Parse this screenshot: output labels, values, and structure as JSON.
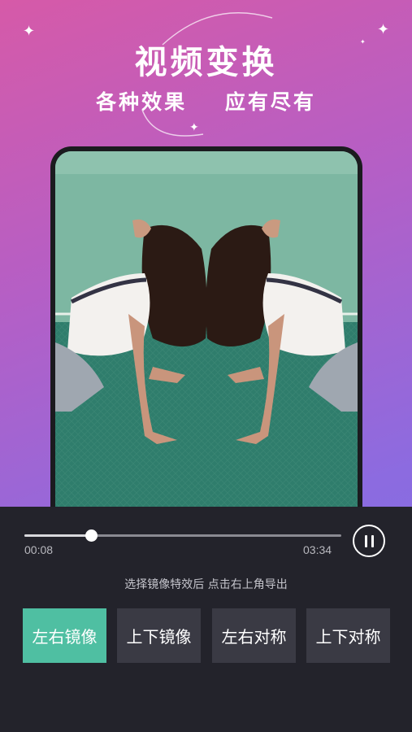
{
  "header": {
    "title": "视频变换",
    "subtitle": "各种效果    应有尽有"
  },
  "player": {
    "current_time": "00:08",
    "total_time": "03:34",
    "progress": 0.21
  },
  "hint": "选择镜像特效后 点击右上角导出",
  "effects": [
    {
      "label": "左右镜像",
      "active": true
    },
    {
      "label": "上下镜像",
      "active": false
    },
    {
      "label": "左右对称",
      "active": false
    },
    {
      "label": "上下对称",
      "active": false
    }
  ],
  "colors": {
    "accent": "#4fbfa2",
    "button": "#3a3a44",
    "panel": "#23232b"
  }
}
